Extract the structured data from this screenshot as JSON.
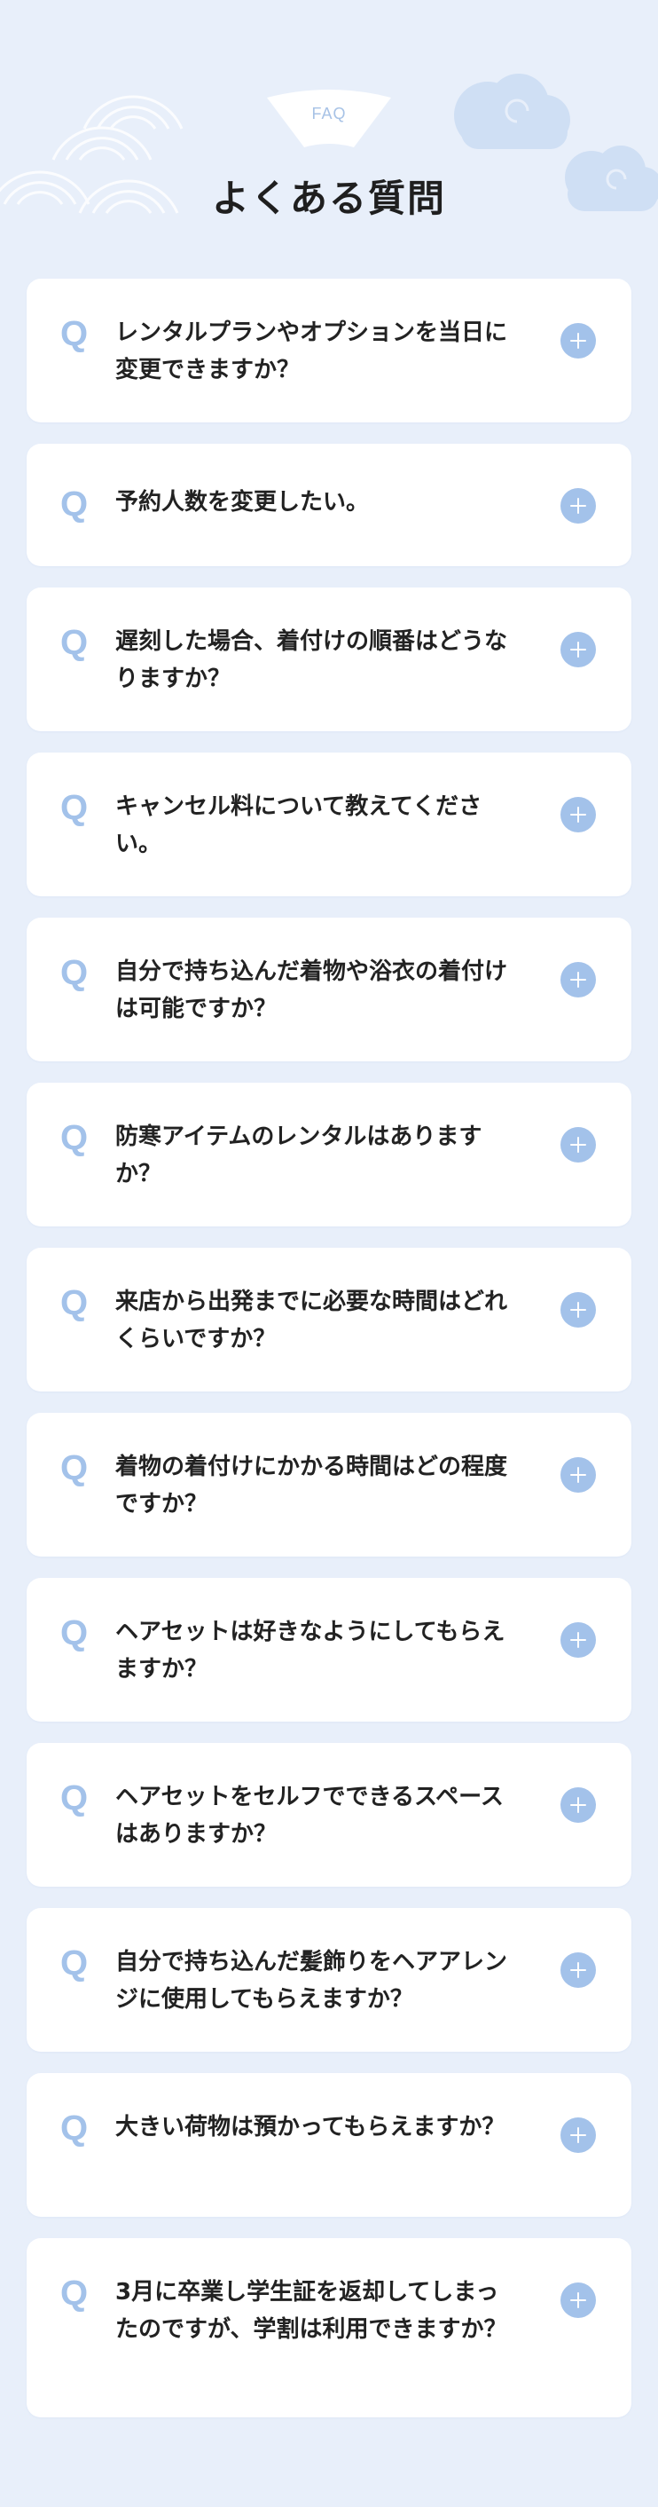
{
  "header": {
    "badge": "FAQ",
    "title": "よくある質問"
  },
  "colors": {
    "background": "#e8effa",
    "card": "#ffffff",
    "accent": "#a3c2ea",
    "text": "#222222"
  },
  "icons": {
    "question": "Q",
    "toggle": "plus-icon"
  },
  "faq": [
    {
      "q": "レンタルプランやオプションを当日に変更できますか？"
    },
    {
      "q": "予約人数を変更したい。"
    },
    {
      "q": "遅刻した場合、着付けの順番はどうなりますか？"
    },
    {
      "q": "キャンセル料について教えてください。"
    },
    {
      "q": "自分で持ち込んだ着物や浴衣の着付けは可能ですか？"
    },
    {
      "q": "防寒アイテムのレンタルはありますか？"
    },
    {
      "q": "来店から出発までに必要な時間はどれくらいですか？"
    },
    {
      "q": "着物の着付けにかかる時間はどの程度ですか？"
    },
    {
      "q": "ヘアセットは好きなようにしてもらえますか？"
    },
    {
      "q": "ヘアセットをセルフでできるスペースはありますか？"
    },
    {
      "q": "自分で持ち込んだ髪飾りをヘアアレンジに使用してもらえますか？"
    },
    {
      "q": "大きい荷物は預かってもらえますか？"
    },
    {
      "q": "3月に卒業し学生証を返却してしまったのですが、学割は利用できますか？"
    }
  ]
}
